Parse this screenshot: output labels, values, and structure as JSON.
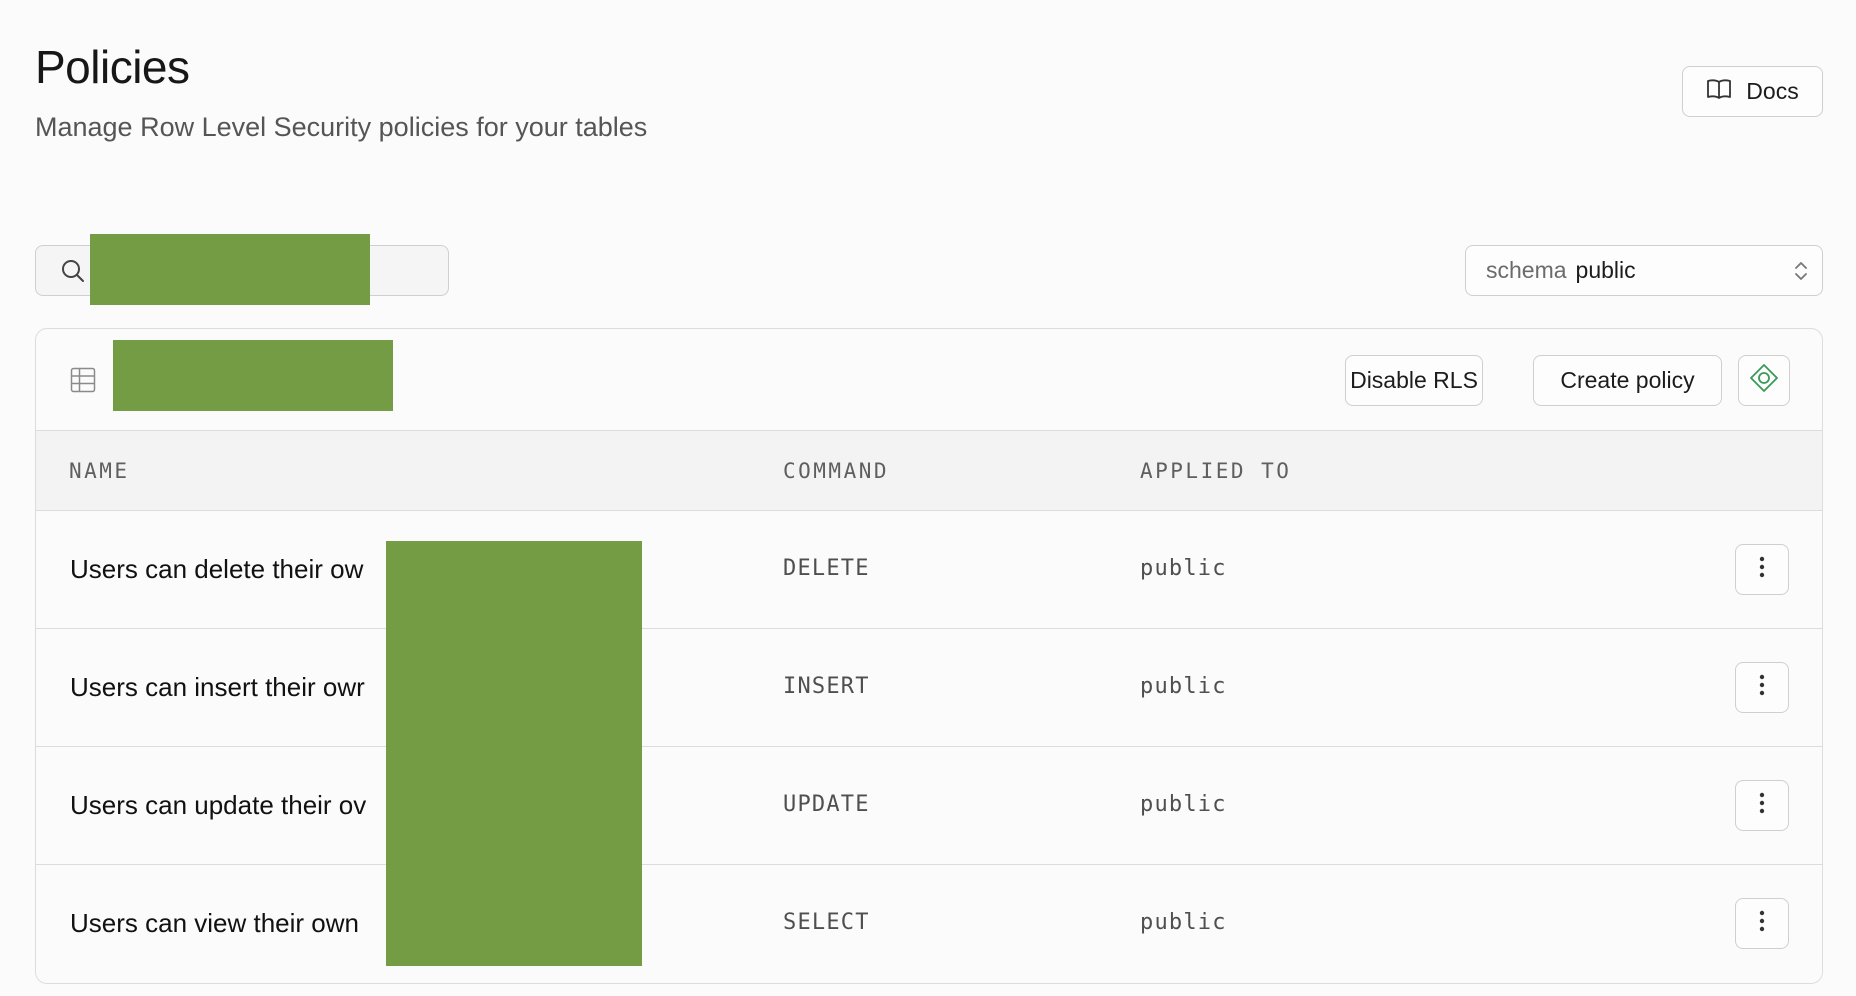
{
  "header": {
    "title": "Policies",
    "subtitle": "Manage Row Level Security policies for your tables",
    "docs_label": "Docs"
  },
  "search": {
    "value": ""
  },
  "schema_select": {
    "prefix": "schema",
    "value": "public"
  },
  "card": {
    "actions": {
      "disable_rls_label": "Disable RLS",
      "create_policy_label": "Create policy"
    },
    "columns": [
      "NAME",
      "COMMAND",
      "APPLIED TO"
    ],
    "rows": [
      {
        "name": "Users can delete their ow",
        "command": "DELETE",
        "applied_to": "public"
      },
      {
        "name": "Users can insert their owr",
        "command": "INSERT",
        "applied_to": "public"
      },
      {
        "name": "Users can update their ov",
        "command": "UPDATE",
        "applied_to": "public"
      },
      {
        "name": "Users can view their own",
        "command": "SELECT",
        "applied_to": "public"
      }
    ]
  },
  "icons": {
    "docs": "book-open-icon",
    "search": "search-icon",
    "schema_select": "chevrons-up-down-icon",
    "table": "table-grid-icon",
    "ai": "ai-assistant-icon",
    "row_menu": "more-vertical-icon"
  },
  "colors": {
    "background": "#fbfbfb",
    "border": "#dcdcdc",
    "header_row": "#f3f3f3",
    "accent_green": "#3ecf8e",
    "redaction": "#749c45"
  }
}
